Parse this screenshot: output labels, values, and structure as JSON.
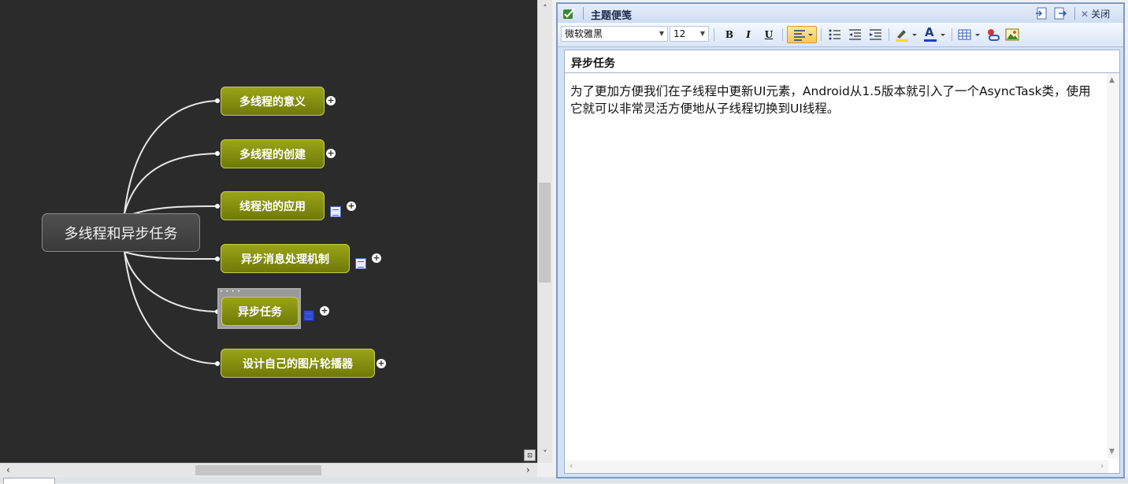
{
  "mindmap": {
    "root": "多线程和异步任务",
    "topics": [
      {
        "label": "多线程的意义",
        "has_note": false,
        "selected": false
      },
      {
        "label": "多线程的创建",
        "has_note": false,
        "selected": false
      },
      {
        "label": "线程池的应用",
        "has_note": true,
        "selected": false
      },
      {
        "label": "异步消息处理机制",
        "has_note": true,
        "selected": false
      },
      {
        "label": "异步任务",
        "has_note": true,
        "selected": true
      },
      {
        "label": "设计自己的图片轮播器",
        "has_note": false,
        "selected": false
      }
    ],
    "expand_symbol": "+",
    "colors": {
      "canvas": "#2b2b2b",
      "topic": "#8a9412",
      "connector": "#e8e8e8"
    }
  },
  "notes_panel": {
    "title": "主题便笺",
    "close_label": "关闭",
    "toolbar": {
      "font_name": "微软雅黑",
      "font_size": "12",
      "bold": "B",
      "italic": "I",
      "underline": "U",
      "font_color_glyph": "A"
    },
    "topic_title": "异步任务",
    "body_text": "为了更加方便我们在子线程中更新UI元素，Android从1.5版本就引入了一个AsyncTask类，使用它就可以非常灵活方便地从子线程切换到UI线程。"
  }
}
